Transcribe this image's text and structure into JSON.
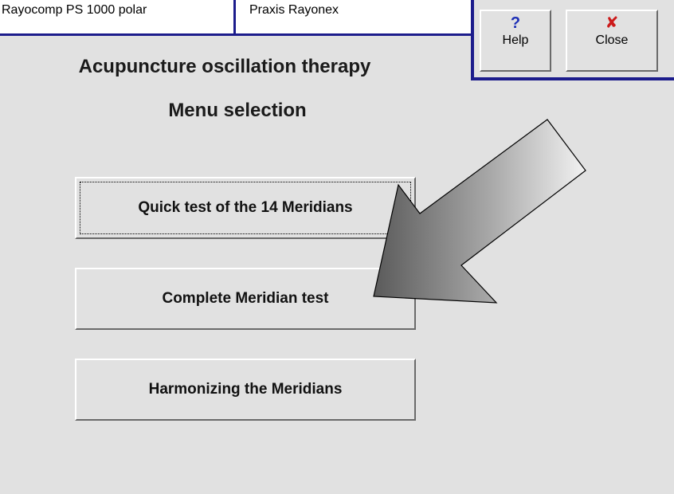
{
  "tabs": {
    "left": "Rayocomp PS 1000 polar",
    "right": "Praxis Rayonex"
  },
  "controls": {
    "help_icon": "?",
    "help_label": "Help",
    "close_icon": "✘",
    "close_label": "Close"
  },
  "heading": {
    "title": "Acupuncture oscillation therapy",
    "subtitle": "Menu selection"
  },
  "menu": {
    "quick_test": "Quick test of the 14 Meridians",
    "complete_test": "Complete Meridian test",
    "harmonize": "Harmonizing the Meridians"
  },
  "colors": {
    "frame": "#1c1c8c",
    "background": "#e1e1e1",
    "help_icon": "#1c2eb6",
    "close_icon": "#cc1a1a"
  }
}
